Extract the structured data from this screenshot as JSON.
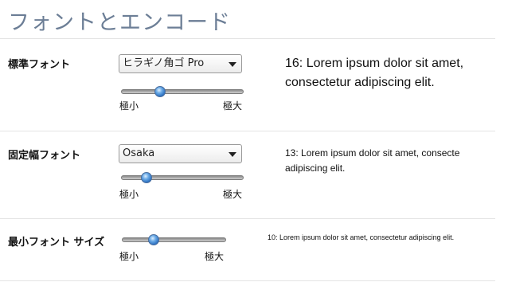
{
  "page": {
    "title": "フォントとエンコード"
  },
  "standard_font": {
    "label": "標準フォント",
    "selected": "ヒラギノ角ゴ Pro",
    "slider_level": 0.31,
    "min_label": "極小",
    "max_label": "極大",
    "preview_line1": "16: Lorem ipsum dolor sit amet,",
    "preview_line2": "consectetur adipiscing elit."
  },
  "fixed_font": {
    "label": "固定幅フォント",
    "selected": "Osaka",
    "slider_level": 0.2,
    "min_label": "極小",
    "max_label": "極大",
    "preview_line1": "13: Lorem ipsum dolor sit amet, consecte",
    "preview_line2": "adipiscing elit."
  },
  "minimum_font": {
    "label": "最小フォント サイズ",
    "slider_level": 0.3,
    "min_label": "極小",
    "max_label": "極大",
    "preview": "10: Lorem ipsum dolor sit amet, consectetur adipiscing elit."
  },
  "icons": {
    "popup_arrow": "chevron-down-icon"
  },
  "colors": {
    "title": "#6c7e96",
    "knob": "#2a6ebf"
  }
}
